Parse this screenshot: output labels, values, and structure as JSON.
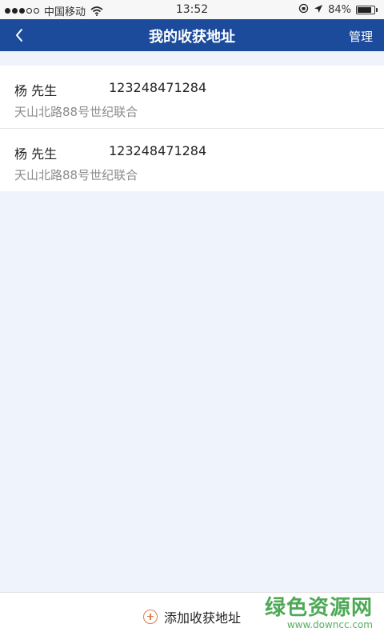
{
  "status_bar": {
    "carrier": "中国移动",
    "time": "13:52",
    "battery_text": "84%",
    "battery_level": 0.84
  },
  "nav": {
    "title": "我的收获地址",
    "manage_label": "管理"
  },
  "addresses": [
    {
      "name": "杨 先生",
      "phone": "123248471284",
      "street": "天山北路88号世纪联合"
    },
    {
      "name": "杨 先生",
      "phone": "123248471284",
      "street": "天山北路88号世纪联合"
    }
  ],
  "bottom": {
    "add_label": "添加收获地址"
  },
  "watermark": {
    "main": "绿色资源网",
    "sub": "www.downcc.com"
  },
  "colors": {
    "nav_bg": "#1c4b9c",
    "page_bg": "#eef3fc",
    "add_icon": "#e07a4a",
    "watermark": "#3aa043"
  }
}
